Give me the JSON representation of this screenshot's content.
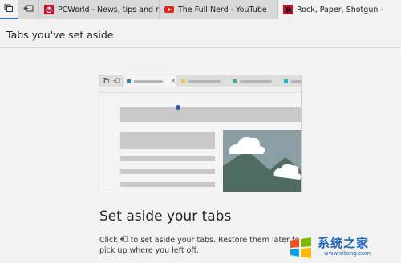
{
  "tabs": [
    {
      "title": "PCWorld - News, tips and re",
      "icon": "pcworld-favicon",
      "color": "#c8102e"
    },
    {
      "title": "The Full Nerd - YouTube",
      "icon": "youtube-favicon",
      "color": "#e62117"
    },
    {
      "title": "Rock, Paper, Shotgun - ",
      "icon": "rps-favicon",
      "color": "#c8102e"
    }
  ],
  "panel": {
    "title": "Tabs you've set aside"
  },
  "empty_state": {
    "heading": "Set aside your tabs",
    "body_prefix": "Click",
    "body_suffix": "to set aside your tabs. Restore them later to pick up where you left off."
  },
  "colors": {
    "accent": "#2b78c8",
    "illus_blue": "#2b78c8",
    "illus_yellow": "#f4c04e",
    "illus_green": "#38b47a",
    "illus_teal": "#1ab5c0"
  },
  "watermark": {
    "text": "系统之家",
    "url": "www.xitong.com"
  }
}
